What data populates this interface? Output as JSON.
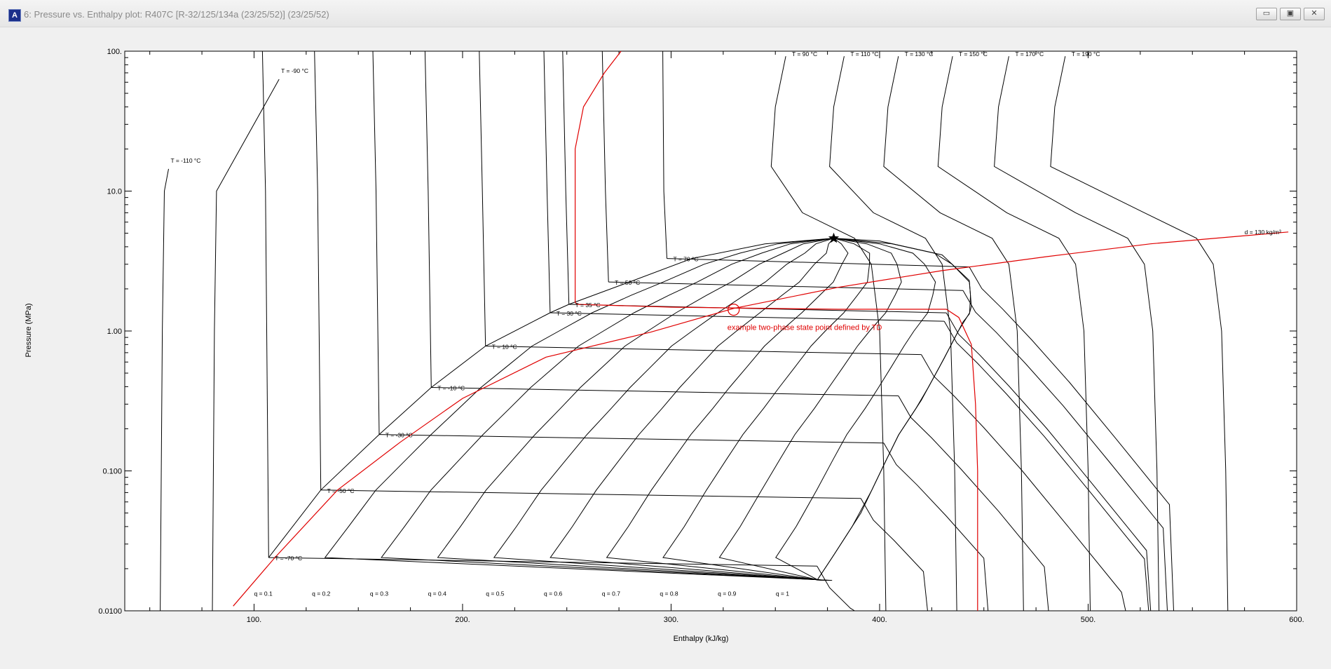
{
  "window": {
    "title": "6: Pressure vs. Enthalpy plot: R407C    [R-32/125/134a (23/25/52)] (23/25/52)",
    "icon_name": "app-logo-icon",
    "minimize_label": "▭",
    "maximize_label": "▣",
    "close_label": "✕"
  },
  "chart_data": {
    "type": "line",
    "xlabel": "Enthalpy (kJ/kg)",
    "ylabel": "Pressure (MPa)",
    "xlim": [
      38,
      600
    ],
    "ylim": [
      0.01,
      100
    ],
    "y_scale": "log",
    "x_ticks": [
      100,
      200,
      300,
      400,
      500,
      600
    ],
    "x_tick_labels": [
      "100.",
      "200.",
      "300.",
      "400.",
      "500.",
      "600."
    ],
    "y_ticks": [
      0.01,
      0.1,
      1,
      10,
      100
    ],
    "y_tick_labels": [
      "0.0100",
      "0.100",
      "1.00",
      "10.0",
      "100."
    ],
    "critical_point": {
      "h": 378,
      "p": 4.6
    },
    "bubble_line": [
      [
        107,
        0.024
      ],
      [
        132,
        0.073
      ],
      [
        160,
        0.182
      ],
      [
        185,
        0.395
      ],
      [
        211,
        0.78
      ],
      [
        242,
        1.35
      ],
      [
        251,
        1.55
      ],
      [
        280,
        2.24
      ],
      [
        310,
        3.3
      ],
      [
        345,
        4.2
      ],
      [
        378,
        4.6
      ]
    ],
    "dew_line": [
      [
        370,
        0.0165
      ],
      [
        378,
        0.025
      ],
      [
        391,
        0.05
      ],
      [
        402,
        0.11
      ],
      [
        409,
        0.18
      ],
      [
        420,
        0.32
      ],
      [
        431,
        0.64
      ],
      [
        440,
        1.16
      ],
      [
        443,
        1.32
      ],
      [
        444,
        1.5
      ],
      [
        443,
        2.3
      ],
      [
        430,
        3.5
      ],
      [
        400,
        4.4
      ],
      [
        378,
        4.6
      ]
    ],
    "isotherms": [
      {
        "label": "T = -110 °C",
        "T": -110,
        "liquid_h": 55,
        "label_h": 60,
        "label_p": 16
      },
      {
        "label": "T = -90 °C",
        "T": -90,
        "liquid_h": 80,
        "label_h": 113,
        "label_p": 70
      },
      {
        "label": "T = -70 °C",
        "T": -70,
        "liquid_h": 107,
        "p_sat": 0.024,
        "vapor_h": 370
      },
      {
        "label": "T = -50 °C",
        "T": -50,
        "liquid_h": 132,
        "p_sat": 0.073,
        "vapor_h": 391
      },
      {
        "label": "T = -30 °C",
        "T": -30,
        "liquid_h": 160,
        "p_sat": 0.182,
        "vapor_h": 402
      },
      {
        "label": "T = -10 °C",
        "T": -10,
        "liquid_h": 185,
        "p_sat": 0.395,
        "vapor_h": 409
      },
      {
        "label": "T = 10 °C",
        "T": 10,
        "liquid_h": 211,
        "p_sat": 0.78,
        "vapor_h": 420
      },
      {
        "label": "T = 30 °C",
        "T": 30,
        "liquid_h": 242,
        "p_sat": 1.35,
        "vapor_h": 431
      },
      {
        "label": "T = 35 °C",
        "T": 35,
        "liquid_h": 251,
        "p_sat": 1.55,
        "vapor_h": 432
      },
      {
        "label": "T = 50 °C",
        "T": 50,
        "liquid_h": 270,
        "p_sat": 2.24,
        "vapor_h": 440
      },
      {
        "label": "T = 70 °C",
        "T": 70,
        "liquid_h": 298,
        "p_sat": 3.3,
        "vapor_h": 443
      },
      {
        "label": "T = 90 °C",
        "T": 90,
        "label_h": 358,
        "label_p": 92
      },
      {
        "label": "T = 110 °C",
        "T": 110,
        "label_h": 386,
        "label_p": 92
      },
      {
        "label": "T = 130 °C",
        "T": 130,
        "label_h": 412,
        "label_p": 92
      },
      {
        "label": "T = 150 °C",
        "T": 150,
        "label_h": 438,
        "label_p": 92
      },
      {
        "label": "T = 170 °C",
        "T": 170,
        "label_h": 465,
        "label_p": 92
      },
      {
        "label": "T = 190 °C",
        "T": 190,
        "label_h": 492,
        "label_p": 92
      }
    ],
    "quality_lines": [
      {
        "label": "q = 0.1",
        "q": 0.1
      },
      {
        "label": "q = 0.2",
        "q": 0.2
      },
      {
        "label": "q = 0.3",
        "q": 0.3
      },
      {
        "label": "q = 0.4",
        "q": 0.4
      },
      {
        "label": "q = 0.5",
        "q": 0.5
      },
      {
        "label": "q = 0.6",
        "q": 0.6
      },
      {
        "label": "q = 0.7",
        "q": 0.7
      },
      {
        "label": "q = 0.8",
        "q": 0.8
      },
      {
        "label": "q = 0.9",
        "q": 0.9
      },
      {
        "label": "q = 1",
        "q": 1
      }
    ],
    "density_line": {
      "label": "d = 130 kg/m³",
      "color": "#e00000",
      "points": [
        [
          90,
          0.0108
        ],
        [
          110,
          0.024
        ],
        [
          140,
          0.073
        ],
        [
          170,
          0.16
        ],
        [
          200,
          0.33
        ],
        [
          240,
          0.65
        ],
        [
          290,
          0.98
        ],
        [
          330,
          1.45
        ],
        [
          380,
          2.05
        ],
        [
          430,
          2.7
        ],
        [
          480,
          3.4
        ],
        [
          530,
          4.2
        ],
        [
          596,
          5.1
        ]
      ]
    },
    "highlight_isotherm": {
      "T": 35,
      "color": "#e00000",
      "points": [
        [
          276,
          100
        ],
        [
          268,
          70
        ],
        [
          258,
          40
        ],
        [
          254,
          20
        ],
        [
          254,
          10
        ],
        [
          254,
          5
        ],
        [
          254,
          2.5
        ],
        [
          254,
          1.6
        ],
        [
          255,
          1.55
        ],
        [
          300,
          1.48
        ],
        [
          380,
          1.43
        ],
        [
          432,
          1.43
        ],
        [
          438,
          1.25
        ],
        [
          444,
          0.8
        ],
        [
          446,
          0.3
        ],
        [
          447,
          0.1
        ],
        [
          447,
          0.03
        ],
        [
          447,
          0.01
        ]
      ]
    },
    "state_point": {
      "h": 330,
      "p": 1.42,
      "color": "#e00000"
    },
    "annotations": [
      {
        "text": "example two-phase state point defined by TD",
        "h": 327,
        "p": 1.02,
        "color": "#e00000"
      }
    ],
    "grid": false,
    "legend": "none"
  }
}
